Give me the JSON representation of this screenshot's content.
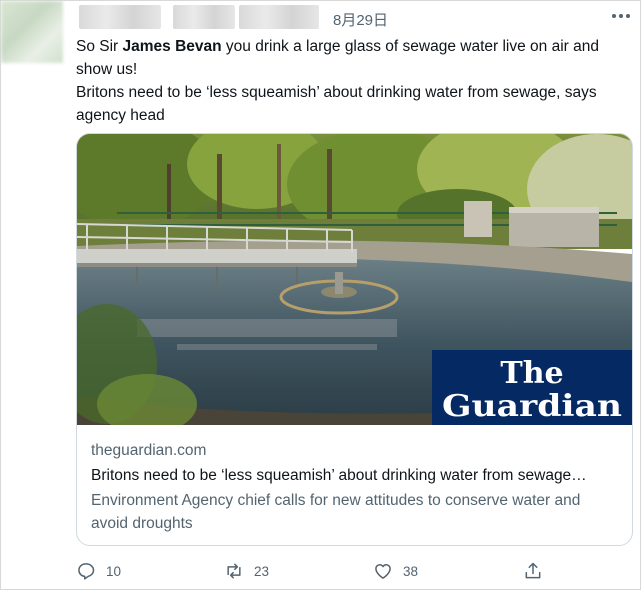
{
  "tweet": {
    "date": "8月29日",
    "text_prefix": "So Sir ",
    "mention_name": "James Bevan",
    "text_suffix": " you drink a large glass of sewage water live on air and show us!",
    "text_line2": "Britons need to be ‘less squeamish’ about drinking water from sewage, says agency head"
  },
  "card": {
    "domain": "theguardian.com",
    "title": "Britons need to be ‘less squeamish’ about drinking water from sewage…",
    "description": "Environment Agency chief calls for new attitudes to conserve water and avoid droughts",
    "logo_text_line1": "The",
    "logo_text_line2": "Guardian",
    "logo_bg": "#052962"
  },
  "actions": {
    "reply_count": "10",
    "retweet_count": "23",
    "like_count": "38",
    "reply_icon": "reply-icon",
    "retweet_icon": "retweet-icon",
    "like_icon": "heart-icon",
    "share_icon": "share-icon"
  }
}
